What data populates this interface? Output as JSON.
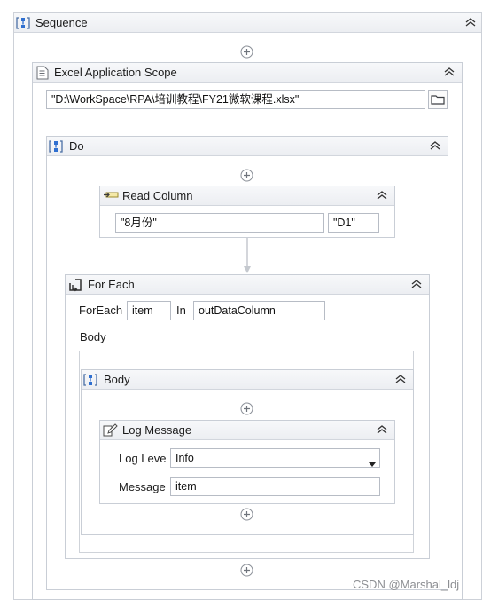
{
  "sequence": {
    "title": "Sequence"
  },
  "excel_scope": {
    "title": "Excel Application Scope",
    "workbook_path": "\"D:\\WorkSpace\\RPA\\培训教程\\FY21微软课程.xlsx\""
  },
  "do_block": {
    "title": "Do"
  },
  "read_column": {
    "title": "Read Column",
    "sheet_value": "\"8月份\"",
    "cell_value": "\"D1\""
  },
  "for_each": {
    "title": "For Each",
    "foreach_label": "ForEach",
    "item_value": "item",
    "in_label": "In",
    "collection_value": "outDataColumn",
    "body_label": "Body"
  },
  "body_sequence": {
    "title": "Body"
  },
  "log_message": {
    "title": "Log Message",
    "level_label": "Log Leve",
    "level_value": "Info",
    "message_label": "Message",
    "message_value": "item"
  },
  "watermark": "CSDN @Marshal_ldj",
  "icons": [
    "sequence-icon",
    "excel-scope-icon",
    "folder-icon",
    "read-column-icon",
    "for-each-icon",
    "log-message-icon",
    "add-activity-icon",
    "collapse-icon",
    "dropdown-arrow-icon"
  ]
}
